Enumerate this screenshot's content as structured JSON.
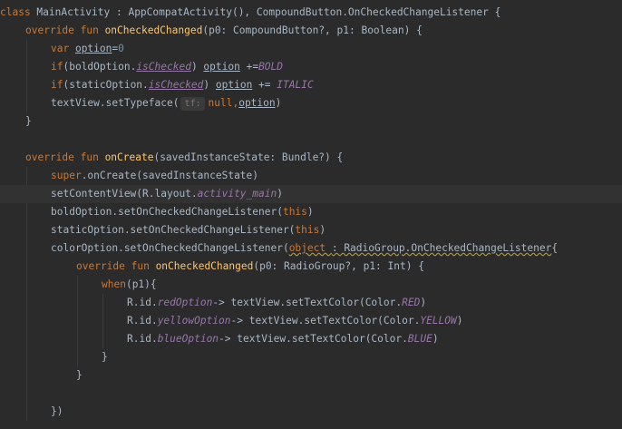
{
  "code": {
    "l1": {
      "a": "class ",
      "b": "MainActivity : AppCompatActivity(), CompoundButton.OnCheckedChangeListener {"
    },
    "l2": {
      "a": "override fun ",
      "b": "onCheckedChanged",
      "c": "(p0: CompoundButton?, p1: Boolean) {"
    },
    "l3": {
      "a": "var ",
      "b": "option",
      "c": "=",
      "d": "0"
    },
    "l4": {
      "a": "if",
      "b": "(boldOption.",
      "c": "isChecked",
      "d": ") ",
      "e": "option",
      "f": " +=",
      "g": "BOLD"
    },
    "l5": {
      "a": "if",
      "b": "(staticOption.",
      "c": "isChecked",
      "d": ") ",
      "e": "option",
      "f": " += ",
      "g": "ITALIC"
    },
    "l6": {
      "a": "textView.setTypeface(",
      "hint": "tf:",
      "b": "null,",
      "c": "option",
      "d": ")"
    },
    "l7": "}",
    "l9": {
      "a": "override fun ",
      "b": "onCreate",
      "c": "(savedInstanceState: Bundle?) {"
    },
    "l10": {
      "a": "super",
      "b": ".onCreate(savedInstanceState)"
    },
    "l11": {
      "a": "setContentView(R.layout.",
      "b": "activity_main",
      "c": ")"
    },
    "l12": {
      "a": "boldOption.setOnCheckedChangeListener(",
      "b": "this",
      "c": ")"
    },
    "l13": {
      "a": "staticOption.setOnCheckedChangeListener(",
      "b": "this",
      "c": ")"
    },
    "l14": {
      "a": "colorOption.setOnCheckedChangeListener(",
      "b": "object ",
      "c": ": RadioGroup.OnCheckedChangeListener",
      "d": "{"
    },
    "l15": {
      "a": "override fun ",
      "b": "onCheckedChanged",
      "c": "(p0: RadioGroup?, p1: Int) {"
    },
    "l16": {
      "a": "when",
      "b": "(p1){"
    },
    "l17": {
      "a": "R.id.",
      "b": "redOption",
      "c": "-> textView.setTextColor(Color.",
      "d": "RED",
      "e": ")"
    },
    "l18": {
      "a": "R.id.",
      "b": "yellowOption",
      "c": "-> textView.setTextColor(Color.",
      "d": "YELLOW",
      "e": ")"
    },
    "l19": {
      "a": "R.id.",
      "b": "blueOption",
      "c": "-> textView.setTextColor(Color.",
      "d": "BLUE",
      "e": ")"
    },
    "l20": "}",
    "l21": "}",
    "l23": "})"
  },
  "icons": {
    "gutter": "lightbulb-icon"
  },
  "colors": {
    "background": "#2b2b2b",
    "text": "#a9b7c6",
    "keyword": "#cc7832",
    "function": "#ffc66d",
    "property": "#9876aa",
    "number": "#6897bb",
    "current_line": "#323232"
  }
}
